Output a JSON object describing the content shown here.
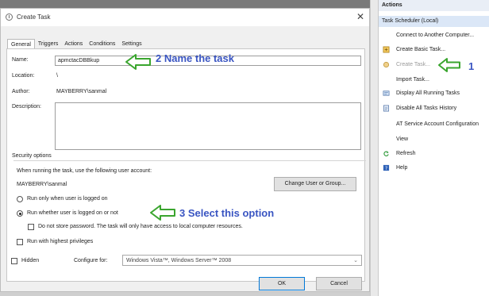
{
  "dialog": {
    "title": "Create Task",
    "close_glyph": "✕",
    "tabs": [
      {
        "label": "General"
      },
      {
        "label": "Triggers"
      },
      {
        "label": "Actions"
      },
      {
        "label": "Conditions"
      },
      {
        "label": "Settings"
      }
    ],
    "general": {
      "name_label": "Name:",
      "name_value": "apmctacDBBkup",
      "location_label": "Location:",
      "location_value": "\\",
      "author_label": "Author:",
      "author_value": "MAYBERRY\\sanmal",
      "description_label": "Description:",
      "description_value": ""
    },
    "security": {
      "group_label": "Security options",
      "account_prompt": "When running the task, use the following user account:",
      "account_value": "MAYBERRY\\sanmal",
      "change_button": "Change User or Group...",
      "radio_logged_on": "Run only when user is logged on",
      "radio_whether": "Run whether user is logged on or not",
      "radio_selected": "Run whether user is logged on or not",
      "no_store_password": "Do not store password.  The task will only have access to local computer resources.",
      "highest_privileges": "Run with highest privileges"
    },
    "hidden_label": "Hidden",
    "configure_label": "Configure for:",
    "configure_value": "Windows Vista™, Windows Server™ 2008",
    "ok_button": "OK",
    "cancel_button": "Cancel"
  },
  "actions_pane": {
    "header": "Actions",
    "section": "Task Scheduler (Local)",
    "items": [
      {
        "label": "Connect to Another Computer...",
        "icon": "none"
      },
      {
        "label": "Create Basic Task...",
        "icon": "basic-task-icon"
      },
      {
        "label": "Create Task...",
        "icon": "create-task-icon",
        "disabled": true
      },
      {
        "label": "Import Task...",
        "icon": "none"
      },
      {
        "label": "Display All Running Tasks",
        "icon": "running-tasks-icon"
      },
      {
        "label": "Disable All Tasks History",
        "icon": "history-icon"
      },
      {
        "label": "AT Service Account Configuration",
        "icon": "none"
      },
      {
        "label": "View",
        "icon": "none"
      },
      {
        "label": "Refresh",
        "icon": "refresh-icon"
      },
      {
        "label": "Help",
        "icon": "help-icon"
      }
    ]
  },
  "annotations": {
    "step1": "1",
    "step2": "2 Name the task",
    "step3": "3 Select this option",
    "color": "#3a55c2",
    "arrow_color": "#3aa52e"
  }
}
